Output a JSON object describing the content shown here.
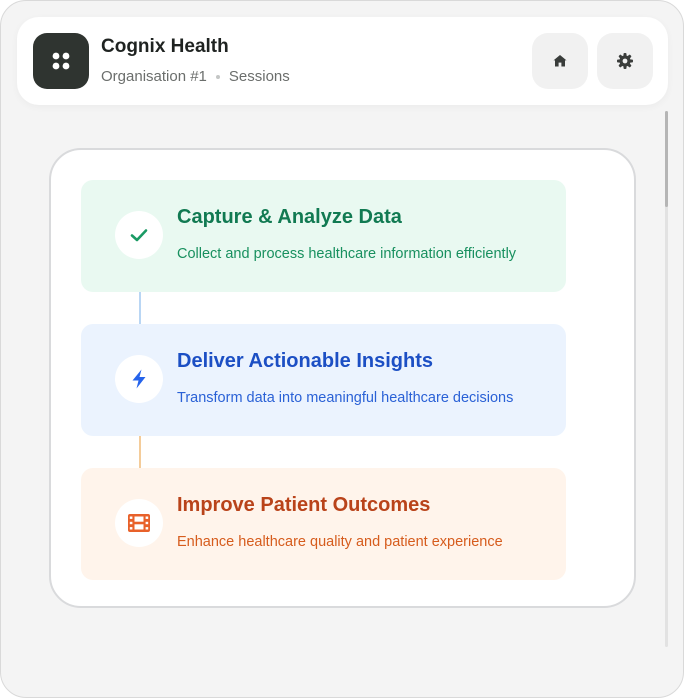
{
  "header": {
    "app_title": "Cognix Health",
    "organisation": "Organisation #1",
    "section": "Sessions",
    "logo_icon": "grid-dots-icon",
    "home_icon": "home-icon",
    "settings_icon": "gear-icon"
  },
  "steps": [
    {
      "title": "Capture & Analyze Data",
      "description": "Collect and process healthcare information efficiently",
      "icon": "checkmark-icon",
      "color": "#117a52",
      "background": "#e9f9f1"
    },
    {
      "title": "Deliver Actionable Insights",
      "description": "Transform data into meaningful healthcare decisions",
      "icon": "lightning-icon",
      "color": "#1c4fc4",
      "background": "#ebf3fe"
    },
    {
      "title": "Improve Patient Outcomes",
      "description": "Enhance healthcare quality and patient experience",
      "icon": "film-icon",
      "color": "#b9431a",
      "background": "#fff4eb"
    }
  ]
}
